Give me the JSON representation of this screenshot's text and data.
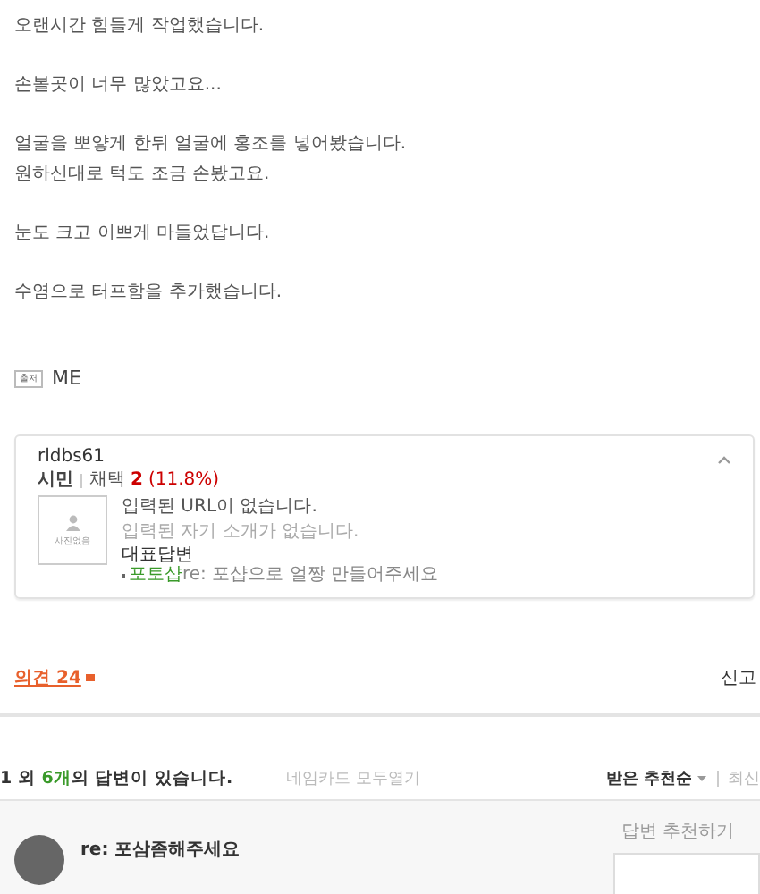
{
  "post": {
    "paragraphs": [
      [
        "오랜시간 힘들게 작업했습니다."
      ],
      [
        "손볼곳이 너무 많았고요..."
      ],
      [
        "얼굴을 뽀얗게 한뒤 얼굴에 홍조를 넣어봤습니다.",
        "원하신대로 턱도 조금 손봤고요."
      ],
      [
        "눈도 크고 이쁘게 마들었답니다."
      ],
      [
        "수염으로 터프함을 추가했습니다."
      ]
    ]
  },
  "source": {
    "badge": "출처",
    "value": "ME"
  },
  "profile_card": {
    "expanded": true,
    "username": "rldbs61",
    "rank": "시민",
    "adopted_label": "채택",
    "adopted_count": "2",
    "adopted_rate": "(11.8%)",
    "photo_placeholder": "사진없음",
    "url": "입력된 URL이 없습니다.",
    "intro": "입력된 자기 소개가 없습니다.",
    "featured_label": "대표답변",
    "featured_category": "포토샵",
    "featured_title": "re: 포샵으로 얼짱 만들어주세요"
  },
  "comments": {
    "label": "의견 24",
    "report": "신고"
  },
  "answers_header": {
    "prefix": "1 외 ",
    "count": "6개",
    "suffix": "의 답변이 있습니다.",
    "namecard": "네임카드 모두열기",
    "sorts": [
      {
        "label": "받은 추천순",
        "selected": true
      },
      {
        "label": "최신",
        "selected": false
      }
    ]
  },
  "answer": {
    "title": "re: 포삼좀해주세요",
    "recommend": "답변 추천하기"
  }
}
